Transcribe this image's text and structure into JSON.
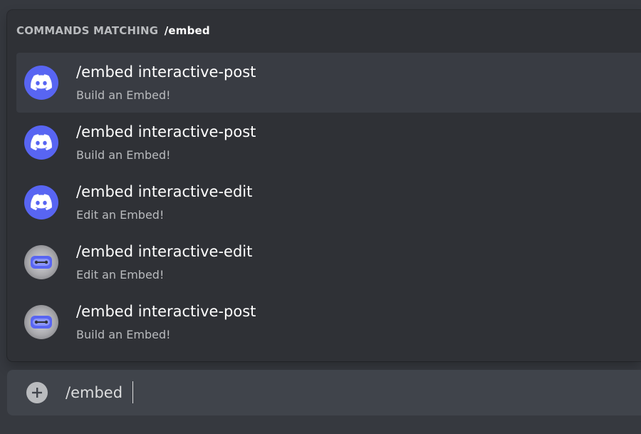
{
  "autocomplete": {
    "header_prefix": "COMMANDS MATCHING",
    "header_query": "/embed",
    "commands": [
      {
        "name": "/embed interactive-post",
        "description": "Build an Embed!",
        "icon": "discord-logo-icon",
        "selected": true
      },
      {
        "name": "/embed interactive-post",
        "description": "Build an Embed!",
        "icon": "discord-logo-icon",
        "selected": false
      },
      {
        "name": "/embed interactive-edit",
        "description": "Edit an Embed!",
        "icon": "discord-logo-icon",
        "selected": false
      },
      {
        "name": "/embed interactive-edit",
        "description": "Edit an Embed!",
        "icon": "bot-avatar-icon",
        "selected": false
      },
      {
        "name": "/embed interactive-post",
        "description": "Build an Embed!",
        "icon": "bot-avatar-icon",
        "selected": false
      }
    ]
  },
  "composer": {
    "value": "/embed",
    "add_icon": "plus-circle-icon"
  },
  "colors": {
    "background": "#36393f",
    "popup": "#2f3136",
    "selected_row": "#393c43",
    "input": "#40444b",
    "blurple": "#5865f2",
    "muted_text": "#b9bbbe",
    "white": "#ffffff"
  }
}
